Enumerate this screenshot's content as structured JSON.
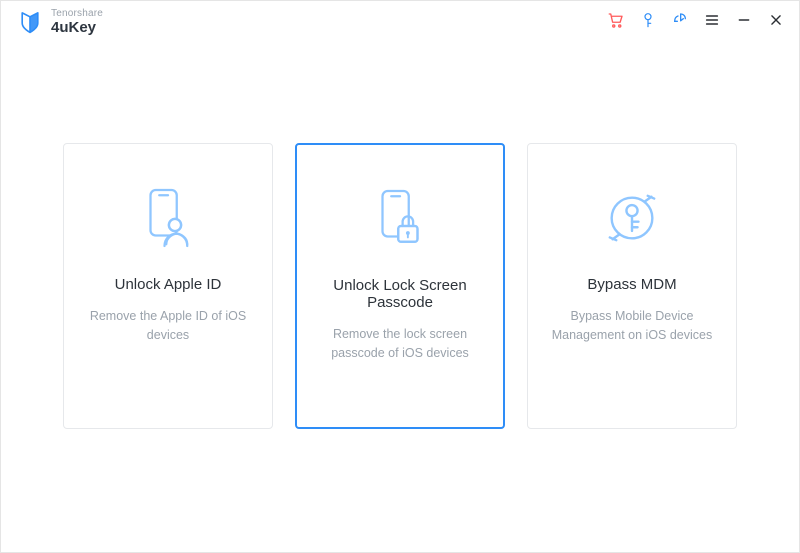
{
  "brand": {
    "company": "Tenorshare",
    "product": "4uKey"
  },
  "titlebar_icons": {
    "cart": "cart-icon",
    "key": "key-icon",
    "share": "share-icon",
    "menu": "menu-icon",
    "minimize": "minimize-icon",
    "close": "close-icon"
  },
  "cards": [
    {
      "title": "Unlock Apple ID",
      "desc": "Remove the Apple ID of iOS devices",
      "selected": false
    },
    {
      "title": "Unlock Lock Screen Passcode",
      "desc": "Remove the lock screen passcode of iOS devices",
      "selected": true
    },
    {
      "title": "Bypass MDM",
      "desc": "Bypass Mobile Device Management on iOS devices",
      "selected": false
    }
  ],
  "colors": {
    "accent": "#2e8df7",
    "danger": "#ff5b5b",
    "text": "#2d333a",
    "muted": "#9aa2ab",
    "border": "#e6e8eb"
  }
}
